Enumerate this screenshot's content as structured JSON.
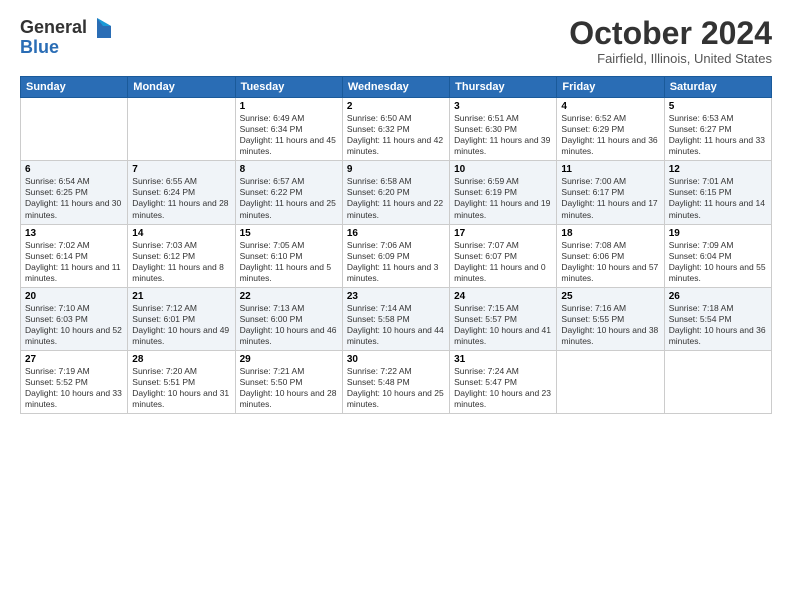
{
  "header": {
    "logo_general": "General",
    "logo_blue": "Blue",
    "title": "October 2024",
    "location": "Fairfield, Illinois, United States"
  },
  "weekdays": [
    "Sunday",
    "Monday",
    "Tuesday",
    "Wednesday",
    "Thursday",
    "Friday",
    "Saturday"
  ],
  "weeks": [
    [
      {
        "day": "",
        "info": ""
      },
      {
        "day": "",
        "info": ""
      },
      {
        "day": "1",
        "info": "Sunrise: 6:49 AM\nSunset: 6:34 PM\nDaylight: 11 hours and 45 minutes."
      },
      {
        "day": "2",
        "info": "Sunrise: 6:50 AM\nSunset: 6:32 PM\nDaylight: 11 hours and 42 minutes."
      },
      {
        "day": "3",
        "info": "Sunrise: 6:51 AM\nSunset: 6:30 PM\nDaylight: 11 hours and 39 minutes."
      },
      {
        "day": "4",
        "info": "Sunrise: 6:52 AM\nSunset: 6:29 PM\nDaylight: 11 hours and 36 minutes."
      },
      {
        "day": "5",
        "info": "Sunrise: 6:53 AM\nSunset: 6:27 PM\nDaylight: 11 hours and 33 minutes."
      }
    ],
    [
      {
        "day": "6",
        "info": "Sunrise: 6:54 AM\nSunset: 6:25 PM\nDaylight: 11 hours and 30 minutes."
      },
      {
        "day": "7",
        "info": "Sunrise: 6:55 AM\nSunset: 6:24 PM\nDaylight: 11 hours and 28 minutes."
      },
      {
        "day": "8",
        "info": "Sunrise: 6:57 AM\nSunset: 6:22 PM\nDaylight: 11 hours and 25 minutes."
      },
      {
        "day": "9",
        "info": "Sunrise: 6:58 AM\nSunset: 6:20 PM\nDaylight: 11 hours and 22 minutes."
      },
      {
        "day": "10",
        "info": "Sunrise: 6:59 AM\nSunset: 6:19 PM\nDaylight: 11 hours and 19 minutes."
      },
      {
        "day": "11",
        "info": "Sunrise: 7:00 AM\nSunset: 6:17 PM\nDaylight: 11 hours and 17 minutes."
      },
      {
        "day": "12",
        "info": "Sunrise: 7:01 AM\nSunset: 6:15 PM\nDaylight: 11 hours and 14 minutes."
      }
    ],
    [
      {
        "day": "13",
        "info": "Sunrise: 7:02 AM\nSunset: 6:14 PM\nDaylight: 11 hours and 11 minutes."
      },
      {
        "day": "14",
        "info": "Sunrise: 7:03 AM\nSunset: 6:12 PM\nDaylight: 11 hours and 8 minutes."
      },
      {
        "day": "15",
        "info": "Sunrise: 7:05 AM\nSunset: 6:10 PM\nDaylight: 11 hours and 5 minutes."
      },
      {
        "day": "16",
        "info": "Sunrise: 7:06 AM\nSunset: 6:09 PM\nDaylight: 11 hours and 3 minutes."
      },
      {
        "day": "17",
        "info": "Sunrise: 7:07 AM\nSunset: 6:07 PM\nDaylight: 11 hours and 0 minutes."
      },
      {
        "day": "18",
        "info": "Sunrise: 7:08 AM\nSunset: 6:06 PM\nDaylight: 10 hours and 57 minutes."
      },
      {
        "day": "19",
        "info": "Sunrise: 7:09 AM\nSunset: 6:04 PM\nDaylight: 10 hours and 55 minutes."
      }
    ],
    [
      {
        "day": "20",
        "info": "Sunrise: 7:10 AM\nSunset: 6:03 PM\nDaylight: 10 hours and 52 minutes."
      },
      {
        "day": "21",
        "info": "Sunrise: 7:12 AM\nSunset: 6:01 PM\nDaylight: 10 hours and 49 minutes."
      },
      {
        "day": "22",
        "info": "Sunrise: 7:13 AM\nSunset: 6:00 PM\nDaylight: 10 hours and 46 minutes."
      },
      {
        "day": "23",
        "info": "Sunrise: 7:14 AM\nSunset: 5:58 PM\nDaylight: 10 hours and 44 minutes."
      },
      {
        "day": "24",
        "info": "Sunrise: 7:15 AM\nSunset: 5:57 PM\nDaylight: 10 hours and 41 minutes."
      },
      {
        "day": "25",
        "info": "Sunrise: 7:16 AM\nSunset: 5:55 PM\nDaylight: 10 hours and 38 minutes."
      },
      {
        "day": "26",
        "info": "Sunrise: 7:18 AM\nSunset: 5:54 PM\nDaylight: 10 hours and 36 minutes."
      }
    ],
    [
      {
        "day": "27",
        "info": "Sunrise: 7:19 AM\nSunset: 5:52 PM\nDaylight: 10 hours and 33 minutes."
      },
      {
        "day": "28",
        "info": "Sunrise: 7:20 AM\nSunset: 5:51 PM\nDaylight: 10 hours and 31 minutes."
      },
      {
        "day": "29",
        "info": "Sunrise: 7:21 AM\nSunset: 5:50 PM\nDaylight: 10 hours and 28 minutes."
      },
      {
        "day": "30",
        "info": "Sunrise: 7:22 AM\nSunset: 5:48 PM\nDaylight: 10 hours and 25 minutes."
      },
      {
        "day": "31",
        "info": "Sunrise: 7:24 AM\nSunset: 5:47 PM\nDaylight: 10 hours and 23 minutes."
      },
      {
        "day": "",
        "info": ""
      },
      {
        "day": "",
        "info": ""
      }
    ]
  ]
}
